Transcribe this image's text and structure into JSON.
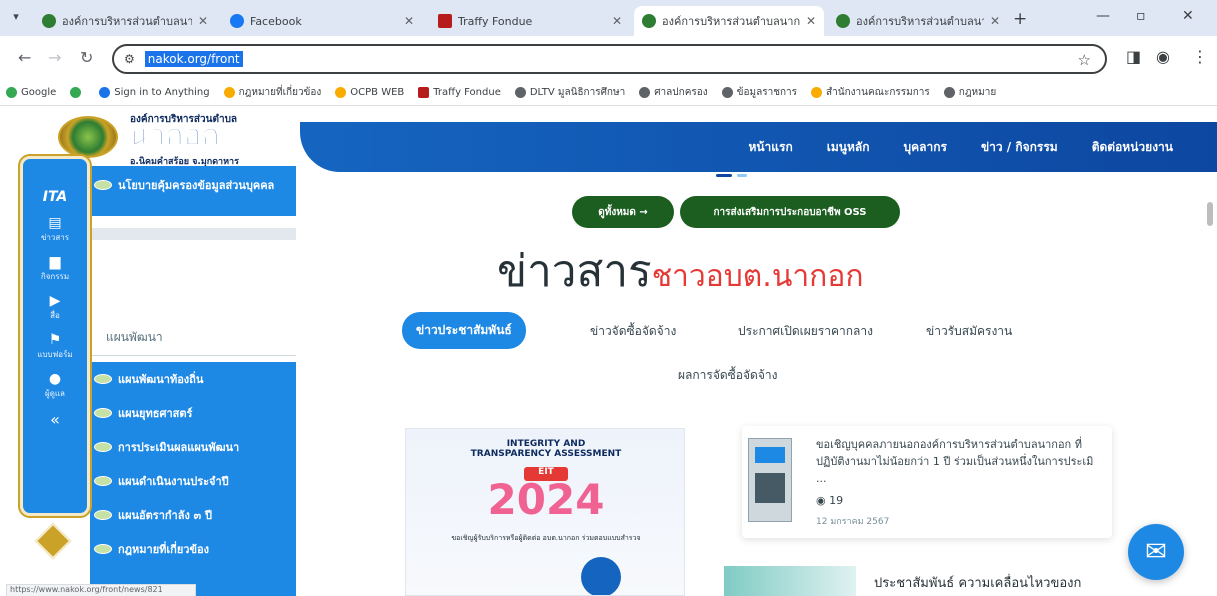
{
  "browser": {
    "tabs": [
      {
        "title": "องค์การบริหารส่วนตำบลนากอก",
        "icon": "site-icon",
        "active": false
      },
      {
        "title": "Facebook",
        "icon": "facebook-icon",
        "active": false
      },
      {
        "title": "Traffy Fondue",
        "icon": "traffy-icon",
        "active": false
      },
      {
        "title": "องค์การบริหารส่วนตำบลนากอก",
        "icon": "site-icon",
        "active": true
      },
      {
        "title": "องค์การบริหารส่วนตำบลนากอก",
        "icon": "site-icon",
        "active": false
      }
    ],
    "url": "nakok.org/front",
    "bookmarks": [
      {
        "label": "Google",
        "icon": "google-icon"
      },
      {
        "label": "",
        "icon": "drive-icon"
      },
      {
        "label": "Sign in to Anything",
        "icon": "globe-icon"
      },
      {
        "label": "กฎหมายที่เกี่ยวข้อง",
        "icon": "globe-icon"
      },
      {
        "label": "OCPB WEB",
        "icon": "globe-icon"
      },
      {
        "label": "Traffy Fondue",
        "icon": "traffy-icon"
      },
      {
        "label": "DLTV มูลนิธิการศึกษา",
        "icon": "globe-icon"
      },
      {
        "label": "ศาลปกครอง",
        "icon": "globe-icon"
      },
      {
        "label": "ข้อมูลราชการ",
        "icon": "globe-icon"
      },
      {
        "label": "สำนักงานคณะกรรมการ",
        "icon": "globe-icon"
      },
      {
        "label": "กฎหมาย",
        "icon": "globe-icon"
      }
    ],
    "status_url": "https://www.nakok.org/front/news/821"
  },
  "site": {
    "org_line": "องค์การบริหารส่วนตำบล",
    "name": "นากอก",
    "province_line": "อ.นิคมคำสร้อย จ.มุกดาหาร",
    "nav": [
      "หน้าแรก",
      "เมนูหลัก",
      "บุคลากร",
      "ข่าว / กิจกรรม",
      "ติดต่อหน่วยงาน"
    ]
  },
  "sidebar": {
    "top_item": "นโยบายคุ้มครองข้อมูลส่วนบุคคล",
    "plan_heading": "แผนพัฒนา",
    "plan_items": [
      "แผนพัฒนาท้องถิ่น",
      "แผนยุทธศาสตร์",
      "การประเมินผลแผนพัฒนา",
      "แผนดำเนินงานประจำปี",
      "แผนอัตรากำลัง ๓ ปี",
      "กฎหมายที่เกี่ยวข้อง"
    ]
  },
  "ita_panel": {
    "brand": "ITA",
    "buttons": [
      {
        "label": "ข่าวสาร",
        "icon": "news-icon"
      },
      {
        "label": "กิจกรรม",
        "icon": "calendar-icon"
      },
      {
        "label": "สื่อ",
        "icon": "play-icon"
      },
      {
        "label": "แบบฟอร์ม",
        "icon": "flag-icon"
      },
      {
        "label": "ผู้ดูแล",
        "icon": "user-icon"
      }
    ],
    "collapse": "«"
  },
  "main": {
    "btn_all": "ดูทั้งหมด →",
    "btn_oss": "การส่งเสริมการประกอบอาชีพ OSS",
    "headline_main": "ข่าวสาร",
    "headline_sub": "ชาวอบต.นากอก",
    "news_tabs": [
      "ข่าวประชาสัมพันธ์",
      "ข่าวจัดซื้อจัดจ้าง",
      "ประกาศเปิดเผยราคากลาง",
      "ข่าวรับสมัครงาน",
      "ผลการจัดซื้อจัดจ้าง"
    ],
    "active_tab": 0,
    "poster": {
      "title": "INTEGRITY AND TRANSPARENCY ASSESSMENT",
      "badge": "EIT",
      "year": "2024",
      "caption": "ขอเชิญผู้รับบริการหรือผู้ติดต่อ อบต.นากอก ร่วมตอบแบบสำรวจ"
    },
    "news_card": {
      "text": "ขอเชิญบุคคลภายนอกองค์การบริหารส่วนตำบลนากอก ที่ปฏิบัติงานมาไม่น้อยกว่า 1 ปี ร่วมเป็นส่วนหนึ่งในการประเมิ ...",
      "views": "19",
      "date": "12 มกราคม 2567"
    },
    "news_card2": {
      "text": "ประชาสัมพันธ์ ความเคลื่อนไหวของก"
    }
  }
}
